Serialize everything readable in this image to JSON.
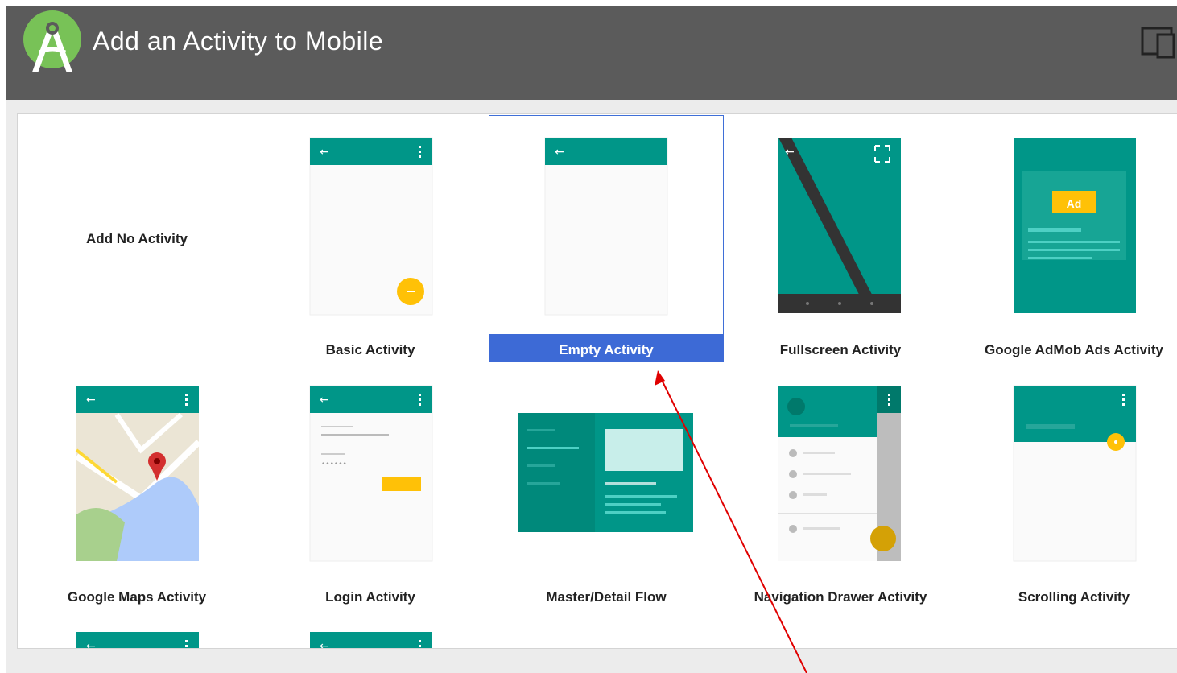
{
  "window": {
    "title": "Add an Activity to Mobile"
  },
  "templates": [
    {
      "label": "Add No Activity",
      "icon": "no-activity"
    },
    {
      "label": "Basic Activity",
      "icon": "basic-activity-thumbnail"
    },
    {
      "label": "Empty Activity",
      "icon": "empty-activity-thumbnail",
      "selected": true
    },
    {
      "label": "Fullscreen Activity",
      "icon": "fullscreen-activity-thumbnail"
    },
    {
      "label": "Google AdMob Ads Activity",
      "icon": "admob-activity-thumbnail",
      "ad_badge": "Ad"
    },
    {
      "label": "Google Maps Activity",
      "icon": "maps-activity-thumbnail"
    },
    {
      "label": "Login Activity",
      "icon": "login-activity-thumbnail"
    },
    {
      "label": "Master/Detail Flow",
      "icon": "master-detail-thumbnail"
    },
    {
      "label": "Navigation Drawer Activity",
      "icon": "navigation-drawer-thumbnail"
    },
    {
      "label": "Scrolling Activity",
      "icon": "scrolling-activity-thumbnail"
    }
  ],
  "colors": {
    "teal": "#009688",
    "teal_dark": "#00796b",
    "amber": "#ffc107",
    "selection": "#3d6ad6",
    "annotation_arrow": "#e00000"
  }
}
